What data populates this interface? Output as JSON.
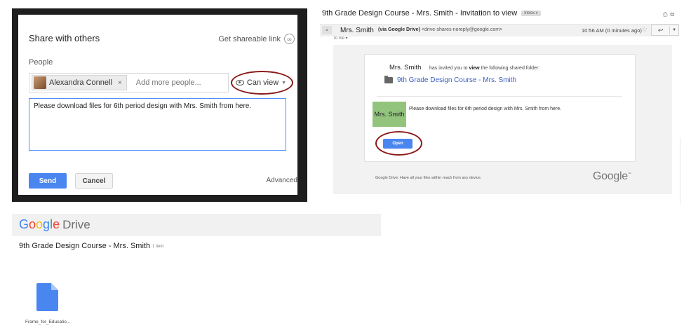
{
  "share_dialog": {
    "title": "Share with others",
    "shareable_link": "Get shareable link",
    "people_label": "People",
    "chip_name": "Alexandra Connell",
    "chip_remove": "×",
    "add_people_placeholder": "Add more people...",
    "permission": "Can view",
    "message": "Please download files for 6th period design with Mrs. Smith from here.",
    "send": "Send",
    "cancel": "Cancel",
    "advanced": "Advanced",
    "accent_color": "#4a86f0"
  },
  "email": {
    "subject": "9th Grade Design Course - Mrs. Smith - Invitation to view",
    "inbox_badge": "Inbox   x",
    "sender_name": "Mrs. Smith",
    "sender_via": "(via Google Drive)",
    "sender_email": "<drive-shares-noreply@google.com>",
    "time": "10:56 AM (0 minutes ago)",
    "to": "to me",
    "invite_name": "Mrs. Smith",
    "invite_text_pre": "has invited you to ",
    "invite_text_bold": "view",
    "invite_text_post": " the following shared folder:",
    "folder_name": "9th Grade Design Course - Mrs. Smith",
    "avatar_text": "Mrs. Smith",
    "message": "Please download files for 6th period design with Mrs. Smith from here.",
    "open": "Open",
    "footer": "Google Drive: Have all your files within reach from any device.",
    "google_logo": "Google"
  },
  "drive": {
    "logo_word": "Drive",
    "folder_title": "9th Grade Design Course - Mrs. Smith",
    "item_count": "1 item",
    "file_name": "Frame_for_Educatio..."
  },
  "icons": {
    "link": "link-icon",
    "eye": "eye-icon",
    "folder": "folder-icon",
    "file": "file-icon",
    "star": "star-icon",
    "reply": "reply-icon",
    "print": "print-icon"
  },
  "annotation_color": "#8b1a1a"
}
